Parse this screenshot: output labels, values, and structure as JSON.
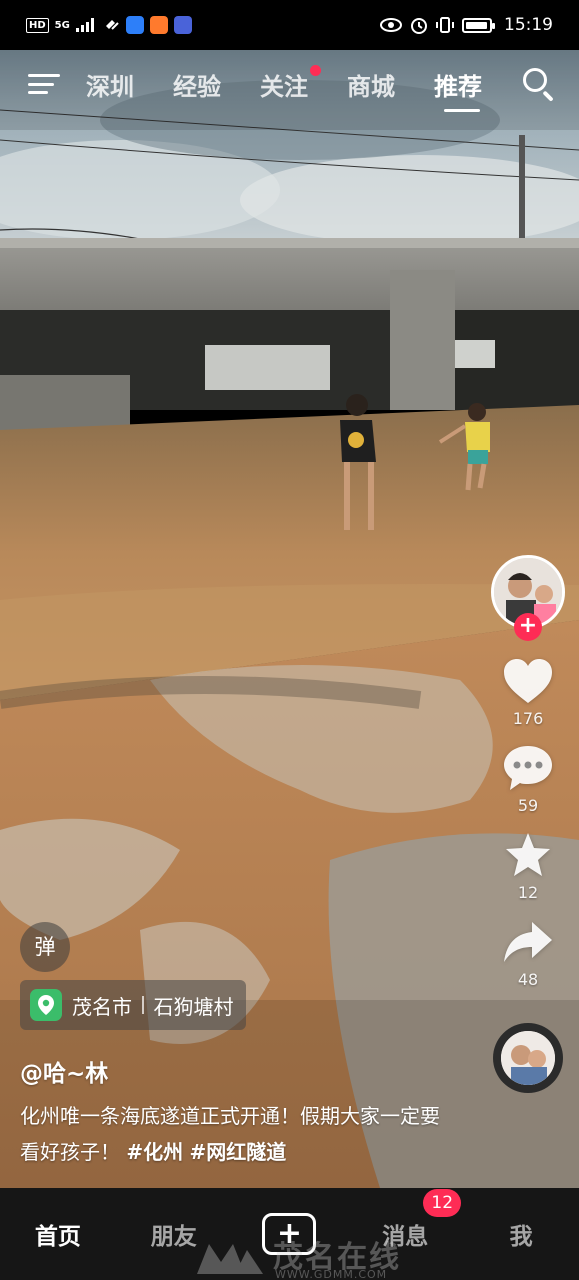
{
  "status_bar": {
    "left_badges": [
      "HD",
      "5G"
    ],
    "time": "15:19",
    "battery_level": 0.8,
    "icons": [
      "signal-icon",
      "wifi-icon",
      "app-icon-blue",
      "app-icon-orange",
      "app-icon-1688",
      "eye-icon",
      "alarm-icon",
      "vibrate-icon",
      "battery-icon"
    ]
  },
  "top_nav": {
    "menu_icon": "hamburger-menu-icon",
    "tabs": [
      {
        "label": "深圳",
        "active": false
      },
      {
        "label": "经验",
        "active": false
      },
      {
        "label": "关注",
        "active": false,
        "has_dot": true
      },
      {
        "label": "商城",
        "active": false
      },
      {
        "label": "推荐",
        "active": true
      }
    ],
    "search_icon": "search-icon"
  },
  "rail": {
    "avatar_icon": "author-avatar",
    "follow_icon": "follow-plus-icon",
    "like_count": "176",
    "comment_count": "59",
    "favorite_count": "12",
    "share_count": "48",
    "music_icon": "music-disc-avatar"
  },
  "video_info": {
    "danmu_label": "弹",
    "location_city": "茂名市",
    "location_place": "石狗塘村",
    "author": "@哈~林",
    "caption_text": "化州唯一条海底遂道正式开通！假期大家一定要看好孩子！",
    "hashtags": [
      "#化州",
      "#网红隧道"
    ]
  },
  "bottom_nav": {
    "items": [
      {
        "label": "首页",
        "active": true
      },
      {
        "label": "朋友",
        "active": false
      },
      {
        "label": "+",
        "active": false
      },
      {
        "label": "消息",
        "active": false,
        "badge": "12"
      },
      {
        "label": "我",
        "active": false
      }
    ]
  },
  "watermark": {
    "text": "茂名在线",
    "url": "WWW.GDMM.COM"
  },
  "colors": {
    "accent_red": "#fe2c55",
    "location_green": "#3bbd6a",
    "nav_background": "#161616"
  }
}
